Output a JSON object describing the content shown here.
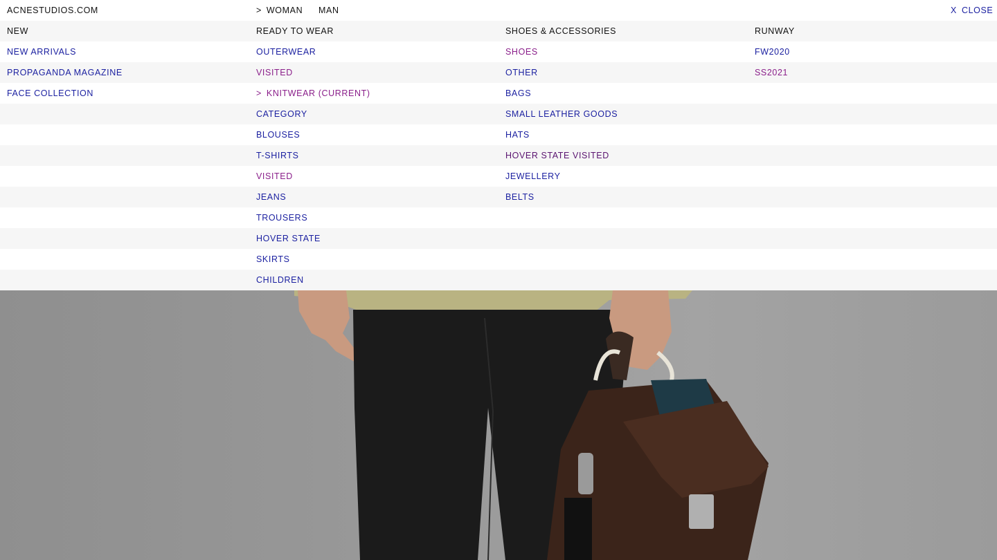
{
  "header": {
    "brand": "ACNESTUDIOS.COM",
    "woman_arrow": ">",
    "woman": "WOMAN",
    "man": "MAN",
    "close_icon": "X",
    "close": "CLOSE"
  },
  "columns": {
    "new": {
      "heading": "NEW",
      "items": [
        "NEW ARRIVALS",
        "PROPAGANDA MAGAZINE",
        "FACE COLLECTION"
      ]
    },
    "ready_to_wear": {
      "heading": "READY TO WEAR",
      "items": [
        "OUTERWEAR",
        "VISITED",
        "KNITWEAR (CURRENT)",
        "CATEGORY",
        "BLOUSES",
        "T-SHIRTS",
        "VISITED",
        "JEANS",
        "TROUSERS",
        "HOVER STATE",
        "SKIRTS",
        "CHILDREN"
      ],
      "current_arrow": ">"
    },
    "shoes_accessories": {
      "heading": "SHOES & ACCESSORIES",
      "items": [
        "SHOES",
        "OTHER",
        "BAGS",
        "SMALL LEATHER GOODS",
        "HATS",
        "HOVER STATE VISITED",
        "JEWELLERY",
        "BELTS"
      ]
    },
    "runway": {
      "heading": "RUNWAY",
      "items": [
        "FW2020",
        "SS2021"
      ]
    }
  },
  "colors": {
    "link": "#1a1fa0",
    "visited": "#8a1e8a",
    "hover": "#5a1470",
    "text": "#111111",
    "row_alt": "#f6f6f6"
  },
  "icons": {
    "nav_arrow": "chevron-right-icon",
    "close": "close-icon"
  }
}
